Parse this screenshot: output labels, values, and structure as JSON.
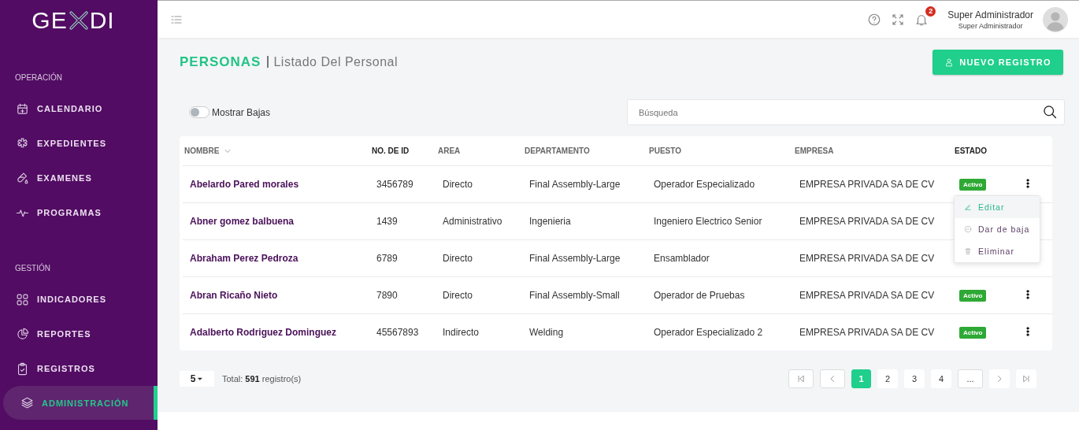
{
  "logo": {
    "left": "GE",
    "right": "DI"
  },
  "sidebar": {
    "sections": [
      {
        "title": "OPERACIÓN",
        "items": [
          {
            "label": "CALENDARIO",
            "selected": false
          },
          {
            "label": "EXPEDIENTES",
            "selected": false
          },
          {
            "label": "EXAMENES",
            "selected": false
          },
          {
            "label": "PROGRAMAS",
            "selected": false
          }
        ]
      },
      {
        "title": "GESTIÓN",
        "items": [
          {
            "label": "INDICADORES",
            "selected": false
          },
          {
            "label": "REPORTES",
            "selected": false
          },
          {
            "label": "REGISTROS",
            "selected": false
          },
          {
            "label": "ADMINISTRACIÓN",
            "selected": true
          }
        ]
      }
    ]
  },
  "topbar": {
    "notifications": "2",
    "user": {
      "name": "Super Administrador",
      "role": "Super Administrador"
    }
  },
  "page": {
    "title": "PERSONAS",
    "subtitle": "Listado Del Personal",
    "new_button": "NUEVO REGISTRO"
  },
  "show_inactive": {
    "label": "Mostrar Bajas",
    "on": false
  },
  "search": {
    "placeholder": "Búsqueda"
  },
  "table": {
    "columns": [
      "NOMBRE",
      "NO. DE ID",
      "AREA",
      "DEPARTAMENTO",
      "PUESTO",
      "EMPRESA",
      "ESTADO"
    ],
    "rows": [
      {
        "cells": [
          "Abelardo Pared morales",
          "3456789",
          "Directo",
          "Final Assembly-Large",
          "Operador Especializado",
          "EMPRESA PRIVADA SA DE CV"
        ],
        "status": "Activo"
      },
      {
        "cells": [
          "Abner gomez balbuena",
          "1439",
          "Administrativo",
          "Ingenieria",
          "Ingeniero Electrico Senior",
          "EMPRESA PRIVADA SA DE CV"
        ],
        "status": null
      },
      {
        "cells": [
          "Abraham Perez Pedroza",
          "6789",
          "Directo",
          "Final Assembly-Large",
          "Ensamblador",
          "EMPRESA PRIVADA SA DE CV"
        ],
        "status": null
      },
      {
        "cells": [
          "Abran Ricaño Nieto",
          "7890",
          "Directo",
          "Final Assembly-Small",
          "Operador de Pruebas",
          "EMPRESA PRIVADA SA DE CV"
        ],
        "status": "Activo"
      },
      {
        "cells": [
          "Adalberto Rodriguez Dominguez",
          "45567893",
          "Indirecto",
          "Welding",
          "Operador Especializado 2",
          "EMPRESA PRIVADA SA DE CV"
        ],
        "status": "Activo"
      }
    ]
  },
  "row_menu": {
    "items": [
      {
        "label": "Editar",
        "selected": true
      },
      {
        "label": "Dar de baja",
        "selected": false
      },
      {
        "label": "Eliminar",
        "selected": false
      }
    ]
  },
  "footer": {
    "page_size": "5",
    "total": "Total: **591** registro(s)"
  },
  "pagination": [
    {
      "kind": "first",
      "disabled": true
    },
    {
      "kind": "prev",
      "disabled": true
    },
    {
      "kind": "page",
      "label": "1",
      "selected": true
    },
    {
      "kind": "page",
      "label": "2",
      "selected": false
    },
    {
      "kind": "page",
      "label": "3",
      "selected": false
    },
    {
      "kind": "page",
      "label": "4",
      "selected": false
    },
    {
      "kind": "more",
      "label": "..."
    },
    {
      "kind": "next",
      "disabled": false
    },
    {
      "kind": "last",
      "disabled": false
    }
  ]
}
